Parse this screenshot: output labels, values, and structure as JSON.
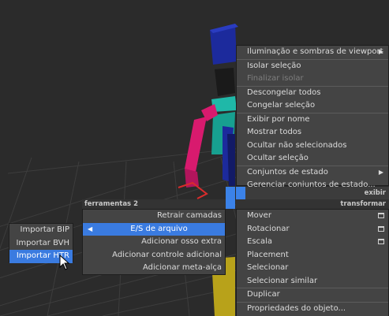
{
  "main_menu": {
    "items": [
      {
        "label": "Iluminação e sombras de viewport",
        "state": "normal",
        "submenu": true
      },
      {
        "label": "Isolar seleção",
        "state": "normal"
      },
      {
        "label": "Finalizar isolar",
        "state": "disabled"
      },
      {
        "label": "Descongelar todos",
        "state": "normal"
      },
      {
        "label": "Congelar seleção",
        "state": "normal"
      },
      {
        "label": "Exibir por nome",
        "state": "normal"
      },
      {
        "label": "Mostrar todos",
        "state": "normal"
      },
      {
        "label": "Ocultar não selecionados",
        "state": "normal"
      },
      {
        "label": "Ocultar seleção",
        "state": "normal"
      },
      {
        "label": "Conjuntos de estado",
        "state": "normal",
        "submenu": true
      },
      {
        "label": "Gerenciar conjuntos de estado...",
        "state": "normal"
      }
    ],
    "header_display": "exibir",
    "header_transform": "transformar",
    "transform_items": [
      {
        "label": "Mover",
        "icon": "window-icon"
      },
      {
        "label": "Rotacionar",
        "icon": "window-icon"
      },
      {
        "label": "Escala",
        "icon": "window-icon"
      },
      {
        "label": "Placement"
      },
      {
        "label": "Selecionar"
      },
      {
        "label": "Selecionar similar"
      },
      {
        "label": "Duplicar"
      },
      {
        "label": "Propriedades do objeto..."
      }
    ]
  },
  "tools_menu": {
    "header": "ferramentas 2",
    "items": [
      {
        "label": "Retrair camadas",
        "state": "normal"
      },
      {
        "label": "E/S de arquivo",
        "state": "highlighted",
        "submenu": true
      },
      {
        "label": "Adicionar osso extra",
        "state": "normal"
      },
      {
        "label": "Adicionar controle adicional",
        "state": "normal"
      },
      {
        "label": "Adicionar meta-alça",
        "state": "normal"
      }
    ]
  },
  "io_submenu": {
    "items": [
      {
        "label": "Importar BIP",
        "state": "normal"
      },
      {
        "label": "Importar BVH",
        "state": "normal"
      },
      {
        "label": "Importar HTR",
        "state": "highlighted"
      }
    ]
  },
  "colors": {
    "menu_bg": "#444444",
    "highlight": "#3a7be0",
    "viewport_bg": "#2b2b2b",
    "rig_magenta": "#d81a6e",
    "rig_teal": "#1fb8a8",
    "rig_blue": "#1c2a9c",
    "rig_yellow": "#b8a21a"
  }
}
